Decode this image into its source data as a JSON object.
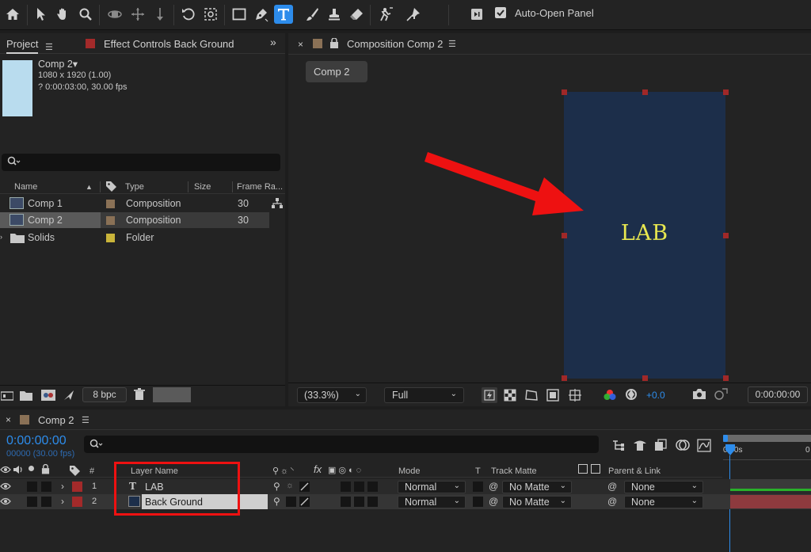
{
  "toolbar": {
    "auto_open_label": "Auto-Open Panel",
    "active_tool": "type-tool",
    "accent": "#2d8ceb"
  },
  "project": {
    "tab_project": "Project",
    "tab_effect": "Effect Controls Back Ground",
    "preview_name": "Comp 2▾",
    "preview_dims": "1080 x 1920 (1.00)",
    "preview_duration": "? 0:00:03:00, 30.00 fps",
    "search_placeholder": "",
    "columns": {
      "name": "Name",
      "type": "Type",
      "size": "Size",
      "frame_rate": "Frame Ra..."
    },
    "items": [
      {
        "name": "Comp 1",
        "type": "Composition",
        "frame_rate": "30",
        "color": "#8a7156"
      },
      {
        "name": "Comp 2",
        "type": "Composition",
        "frame_rate": "30",
        "color": "#8a7156"
      },
      {
        "name": "Solids",
        "type": "Folder",
        "frame_rate": "",
        "color": "#c9b43a"
      }
    ],
    "bpc": "8 bpc"
  },
  "viewer": {
    "tab_title": "Composition Comp 2",
    "comp_button": "Comp 2",
    "canvas_text": "LAB",
    "canvas_bg": "#1c2e4a",
    "text_color": "#e8e850",
    "zoom": "(33.3%)",
    "resolution": "Full",
    "exposure": "+0.0",
    "timecode": "0:00:00:00"
  },
  "timeline": {
    "tab_title": "Comp 2",
    "current_time": "0:00:00:00",
    "frames": "00000 (30.00 fps)",
    "ruler_start": "0:00s",
    "columns": {
      "layer_name": "Layer Name",
      "number": "#",
      "mode": "Mode",
      "t": "T",
      "track_matte": "Track Matte",
      "parent": "Parent & Link"
    },
    "layers": [
      {
        "number": "1",
        "name": "LAB",
        "mode": "Normal",
        "matte": "No Matte",
        "parent": "None"
      },
      {
        "number": "2",
        "name": "Back Ground",
        "mode": "Normal",
        "matte": "No Matte",
        "parent": "None"
      }
    ]
  }
}
